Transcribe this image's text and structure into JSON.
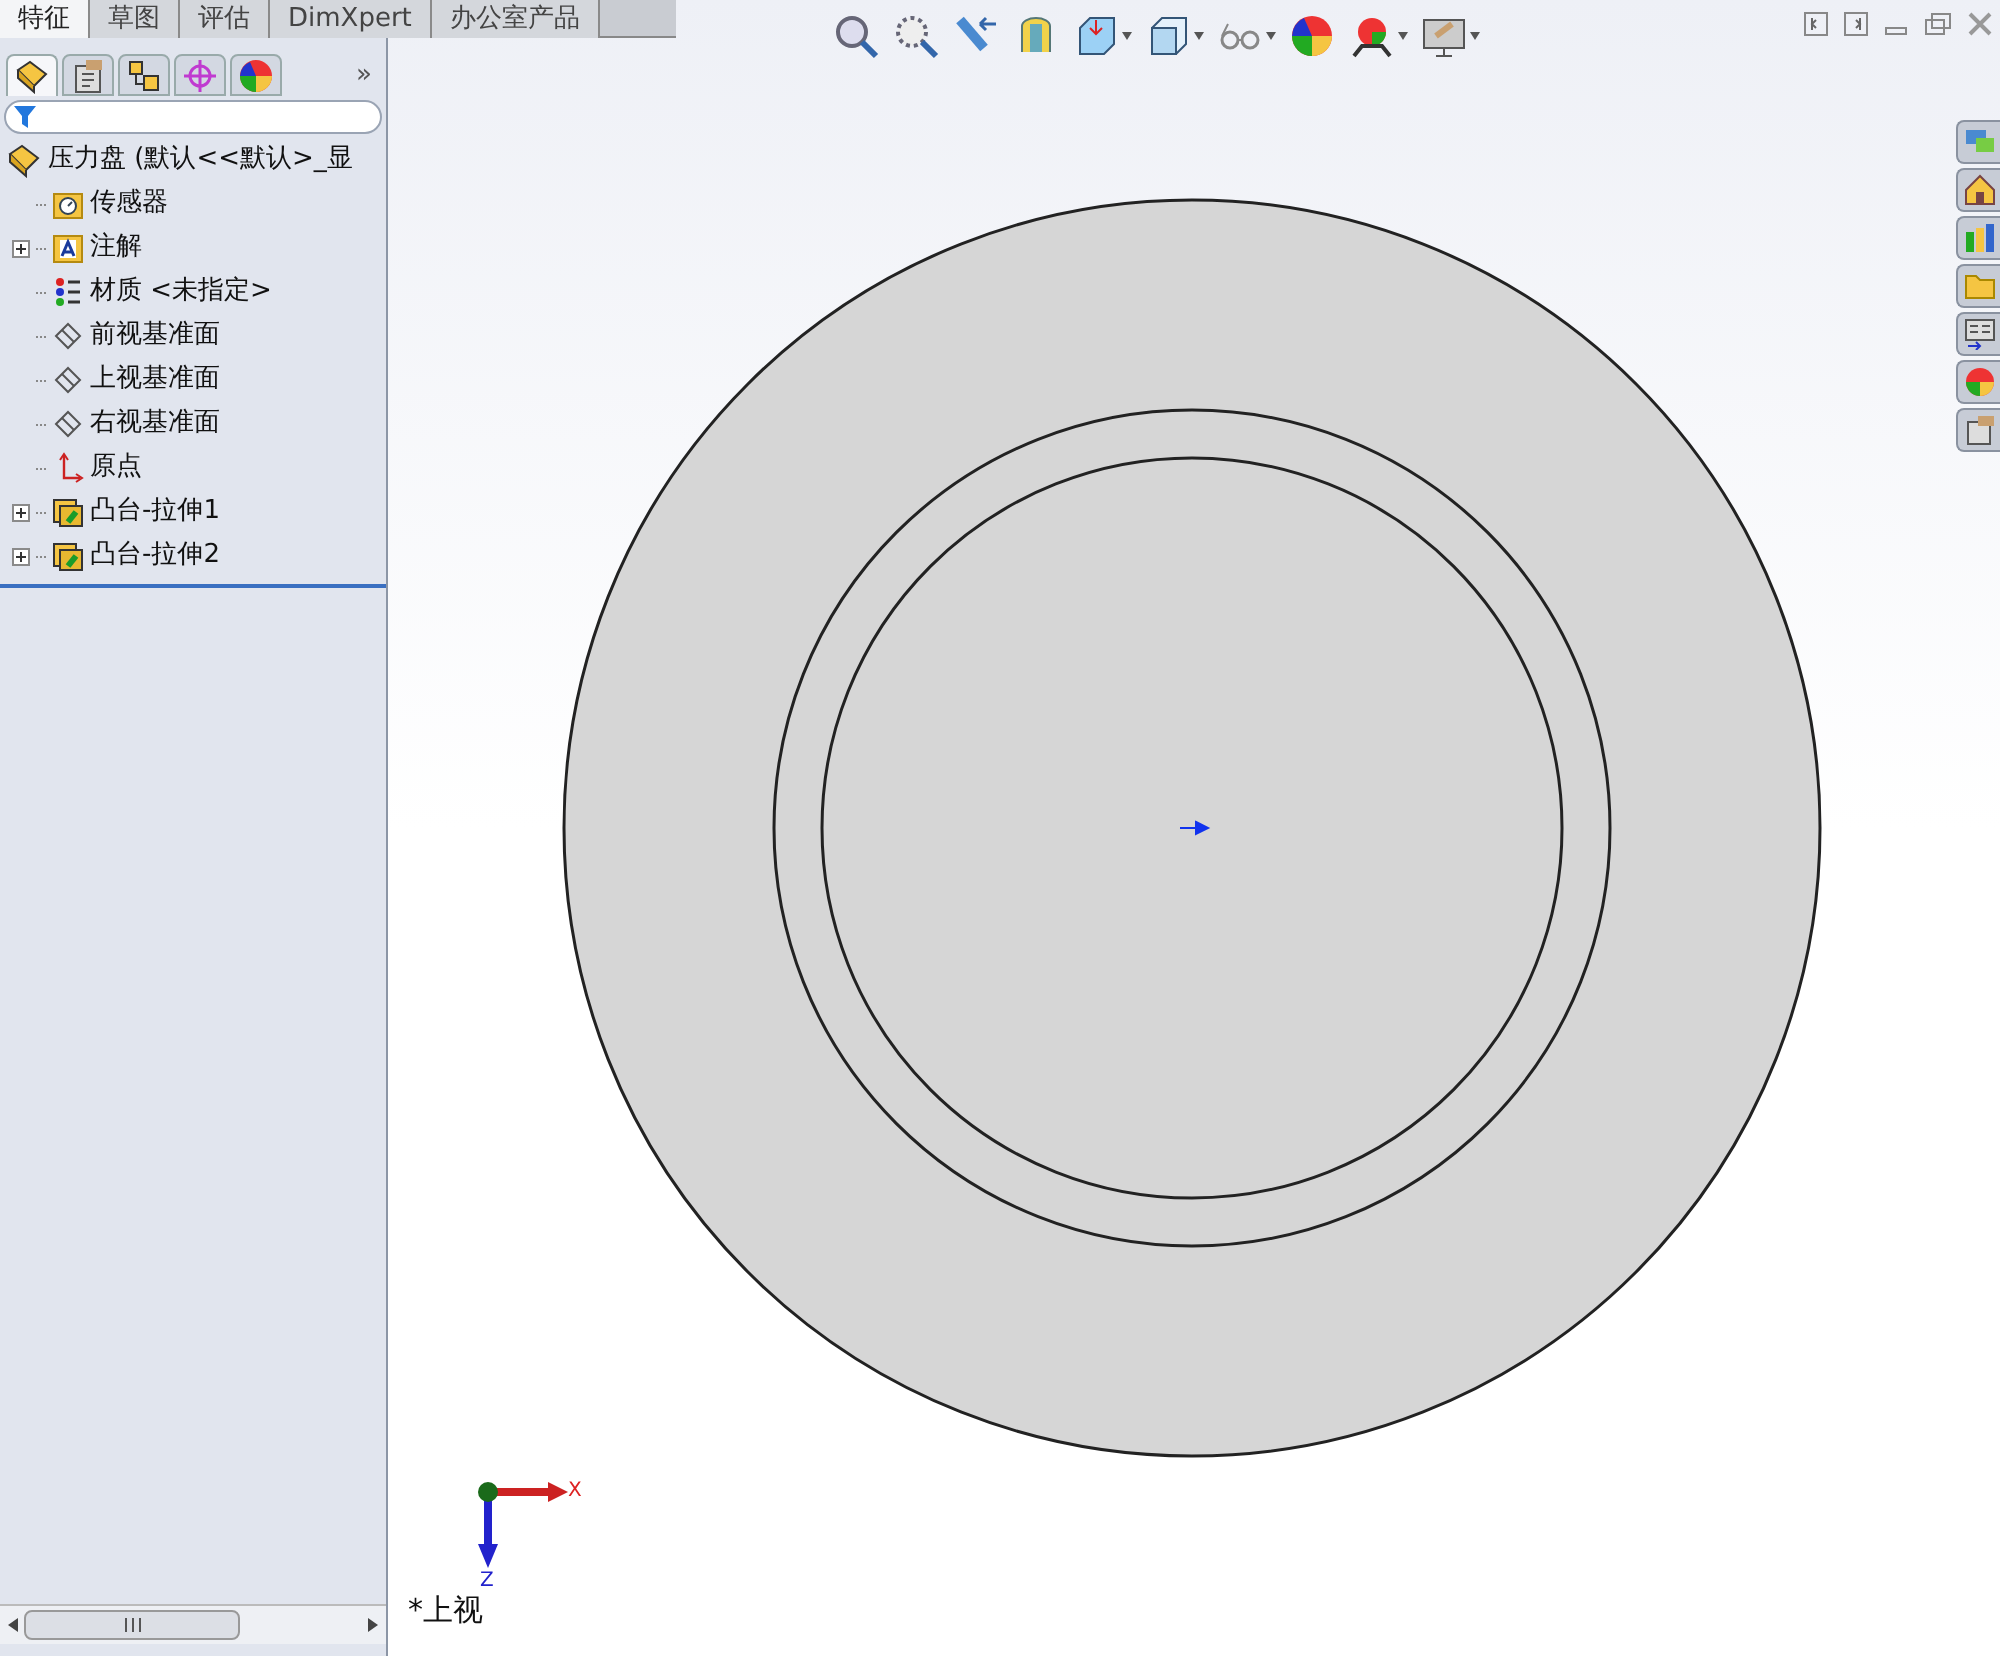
{
  "command_tabs": [
    {
      "label": "特征",
      "selected": true
    },
    {
      "label": "草图",
      "selected": false
    },
    {
      "label": "评估",
      "selected": false
    },
    {
      "label": "DimXpert",
      "selected": false
    },
    {
      "label": "办公室产品",
      "selected": false
    }
  ],
  "panel_tabs": [
    {
      "kind": "feature",
      "selected": true
    },
    {
      "kind": "property",
      "selected": false
    },
    {
      "kind": "config",
      "selected": false
    },
    {
      "kind": "target",
      "selected": false
    },
    {
      "kind": "appearance",
      "selected": false
    }
  ],
  "panel_more": "»",
  "tree": {
    "label": "压力盘  (默认<<默认>_显",
    "children": [
      {
        "label": "传感器",
        "kind": "sensor"
      },
      {
        "label": "注解",
        "kind": "annotation",
        "expanded": false
      },
      {
        "label": "材质 <未指定>",
        "kind": "material"
      },
      {
        "label": "前视基准面",
        "kind": "plane"
      },
      {
        "label": "上视基准面",
        "kind": "plane"
      },
      {
        "label": "右视基准面",
        "kind": "plane"
      },
      {
        "label": "原点",
        "kind": "origin"
      },
      {
        "label": "凸台-拉伸1",
        "kind": "extrude",
        "expanded": false
      },
      {
        "label": "凸台-拉伸2",
        "kind": "extrude",
        "expanded": false
      }
    ]
  },
  "triad": {
    "x_label": "X",
    "z_label": "Z"
  },
  "view_label": "*上视"
}
